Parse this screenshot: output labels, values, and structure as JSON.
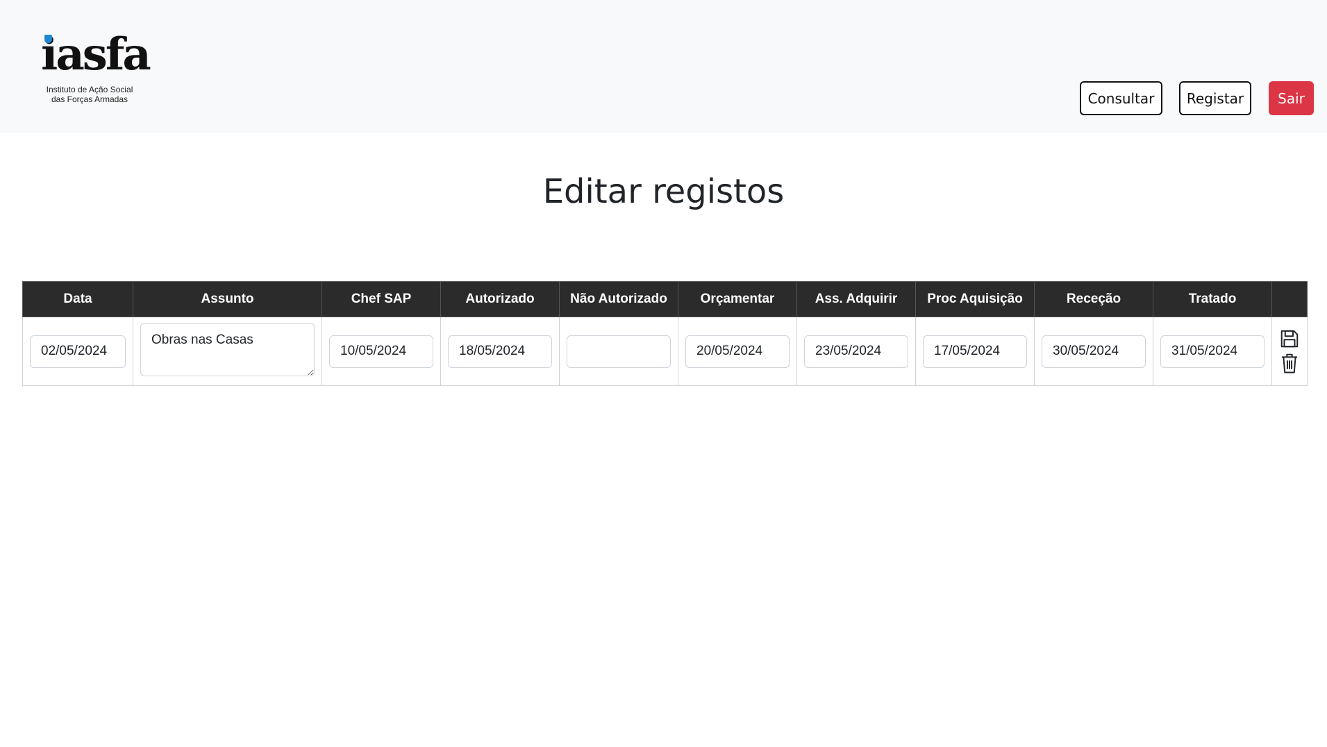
{
  "header": {
    "logo_word": "iasfa",
    "logo_subtitle_line1": "Instituto de Ação Social",
    "logo_subtitle_line2": "das Forças Armadas",
    "nav": {
      "consultar": "Consultar",
      "registar": "Registar",
      "sair": "Sair"
    },
    "colors": {
      "accent_dot": "#1e88d0",
      "danger": "#dc3545"
    }
  },
  "page": {
    "title": "Editar registos"
  },
  "table": {
    "columns": [
      "Data",
      "Assunto",
      "Chef SAP",
      "Autorizado",
      "Não Autorizado",
      "Orçamentar",
      "Ass. Adquirir",
      "Proc Aquisição",
      "Receção",
      "Tratado",
      ""
    ],
    "rows": [
      {
        "data": "02/05/2024",
        "assunto": "Obras nas Casas",
        "chef_sap": "10/05/2024",
        "autorizado": "18/05/2024",
        "nao_autorizado": "",
        "orcamentar": "20/05/2024",
        "ass_adquirir": "23/05/2024",
        "proc_aquisicao": "17/05/2024",
        "rececao": "30/05/2024",
        "tratado": "31/05/2024"
      }
    ],
    "icons": {
      "save": "floppy-disk-icon",
      "delete": "trash-icon"
    }
  }
}
